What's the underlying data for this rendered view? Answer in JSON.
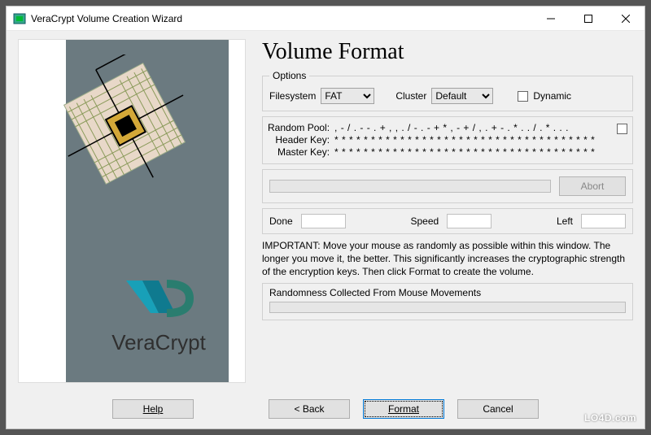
{
  "window": {
    "title": "VeraCrypt Volume Creation Wizard"
  },
  "branding": {
    "product": "VeraCrypt"
  },
  "heading": "Volume Format",
  "options": {
    "legend": "Options",
    "filesystem_label": "Filesystem",
    "filesystem_value": "FAT",
    "cluster_label": "Cluster",
    "cluster_value": "Default",
    "dynamic_label": "Dynamic"
  },
  "pool": {
    "random_pool_label": "Random Pool:",
    "random_pool_value": ", - / . - - . + , , . / - . - + * , - + / , . + - . * . . / . * . . .",
    "header_key_label": "Header Key:",
    "header_key_value": "* * * * * * * * * * * * * * * * * * * * * * * * * * * * * * * * * * * *",
    "master_key_label": "Master Key:",
    "master_key_value": "* * * * * * * * * * * * * * * * * * * * * * * * * * * * * * * * * * * *"
  },
  "progress": {
    "abort_label": "Abort",
    "done_label": "Done",
    "done_value": "",
    "speed_label": "Speed",
    "speed_value": "",
    "left_label": "Left",
    "left_value": ""
  },
  "note_text": "IMPORTANT: Move your mouse as randomly as possible within this window. The longer you move it, the better. This significantly increases the cryptographic strength of the encryption keys. Then click Format to create the volume.",
  "randomness": {
    "label": "Randomness Collected From Mouse Movements"
  },
  "footer": {
    "help": "Help",
    "back": "<  Back",
    "format": "Format",
    "cancel": "Cancel"
  },
  "watermark": "LO4D.com"
}
